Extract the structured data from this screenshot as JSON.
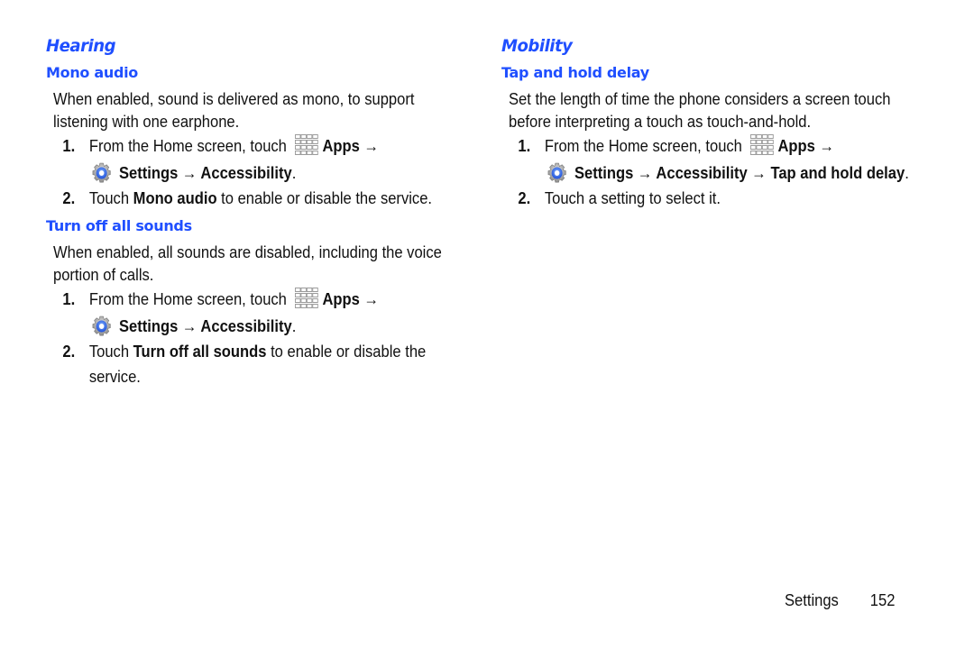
{
  "left_column": {
    "section_title": "Hearing",
    "subsections": [
      {
        "title": "Mono audio",
        "description": "When enabled, sound is delivered as mono, to support listening with one earphone.",
        "steps": [
          {
            "number": "1.",
            "text_prefix": "From the Home screen, touch",
            "apps_label": "Apps →",
            "path": "Settings → Accessibility",
            "suffix": "."
          },
          {
            "number": "2.",
            "text_prefix": "Touch",
            "bold": "Mono audio",
            "text_suffix": "to enable or disable the service."
          }
        ]
      },
      {
        "title": "Turn off all sounds",
        "description": "When enabled, all sounds are disabled, including the voice portion of calls.",
        "steps": [
          {
            "number": "1.",
            "text_prefix": "From the Home screen, touch",
            "apps_label": "Apps →",
            "path": "Settings → Accessibility",
            "suffix": "."
          },
          {
            "number": "2.",
            "text_prefix": "Touch",
            "bold": "Turn off all sounds",
            "text_suffix": "to enable or disable the",
            "text_line2": "service."
          }
        ]
      }
    ]
  },
  "right_column": {
    "section_title": "Mobility",
    "subsections": [
      {
        "title": "Tap and hold delay",
        "description": "Set the length of time the phone considers a screen touch before interpreting a touch as touch-and-hold.",
        "steps": [
          {
            "number": "1.",
            "text_prefix": "From the Home screen, touch",
            "apps_label": "Apps →",
            "path": "Settings → Accessibility → Tap and hold delay",
            "suffix": "."
          },
          {
            "number": "2.",
            "text_prefix": "Touch a setting to select it."
          }
        ]
      }
    ]
  },
  "footer": {
    "section": "Settings",
    "page_number": "152"
  },
  "icons": {
    "apps": "apps-grid-icon",
    "settings": "settings-gear-icon"
  },
  "colors": {
    "heading_blue": "#1f4fff",
    "body_text": "#111111"
  }
}
